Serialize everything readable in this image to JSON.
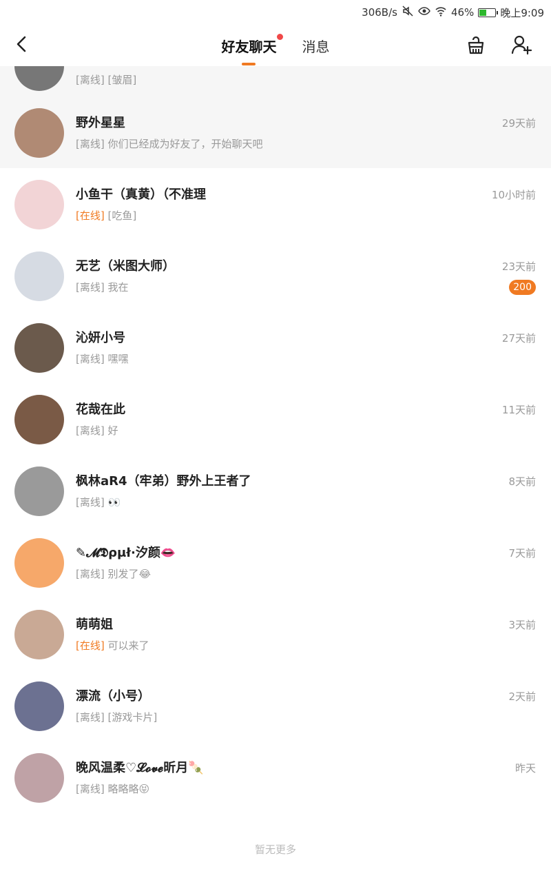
{
  "status_bar": {
    "net_speed": "306B/s",
    "battery_percent": "46%",
    "battery_level": 0.46,
    "time": "晚上9:09",
    "icons": [
      "mute-icon",
      "eye-icon",
      "wifi-icon",
      "battery-icon"
    ]
  },
  "nav": {
    "tabs": [
      {
        "label": "好友聊天",
        "active": true,
        "has_dot": true
      },
      {
        "label": "消息",
        "active": false,
        "has_dot": false
      }
    ],
    "icons": [
      "back-icon",
      "cleaner-icon",
      "add-friend-icon"
    ]
  },
  "partial_row": {
    "status": "[离线]",
    "message": "[皱眉]"
  },
  "chats": [
    {
      "name": "野外星星",
      "status": "[离线]",
      "online": false,
      "message": "你们已经成为好友了，开始聊天吧",
      "time": "29天前",
      "highlight": true,
      "avatar_color": "#b08a74"
    },
    {
      "name": "小鱼干（真黄）（不准理",
      "status": "[在线]",
      "online": true,
      "message": "[吃鱼]",
      "time": "10小时前",
      "avatar_color": "#f2d4d6"
    },
    {
      "name": "无艺（米图大师）",
      "status": "[离线]",
      "online": false,
      "message": "我在",
      "time": "23天前",
      "badge": "200",
      "avatar_color": "#d6dbe3"
    },
    {
      "name": "沁妍小号",
      "status": "[离线]",
      "online": false,
      "message": "嘿嘿",
      "time": "27天前",
      "avatar_color": "#6b5a4c"
    },
    {
      "name": "花哉在此",
      "status": "[离线]",
      "online": false,
      "message": "好",
      "time": "11天前",
      "avatar_color": "#7a5a46"
    },
    {
      "name": "枫林aR4（牢弟）野外上王者了",
      "status": "[离线]",
      "online": false,
      "message": "👀",
      "time": "8天前",
      "avatar_color": "#9a9a9a"
    },
    {
      "name": "✎𝓜𝕯ρμł·汐颜👄",
      "status": "[离线]",
      "online": false,
      "message": "别发了😂",
      "time": "7天前",
      "avatar_color": "#f6a86a"
    },
    {
      "name": "萌萌姐",
      "status": "[在线]",
      "online": true,
      "message": "可以来了",
      "time": "3天前",
      "avatar_color": "#c9a995"
    },
    {
      "name": "漂流（小号）",
      "status": "[离线]",
      "online": false,
      "message": "[游戏卡片]",
      "time": "2天前",
      "avatar_color": "#6c7191"
    },
    {
      "name": "晚风温柔♡𝓛𝓸𝓿𝓮昕月🍡",
      "status": "[离线]",
      "online": false,
      "message": "略略略😝",
      "time": "昨天",
      "avatar_color": "#bfa2a6"
    }
  ],
  "footer": {
    "text": "暂无更多"
  }
}
